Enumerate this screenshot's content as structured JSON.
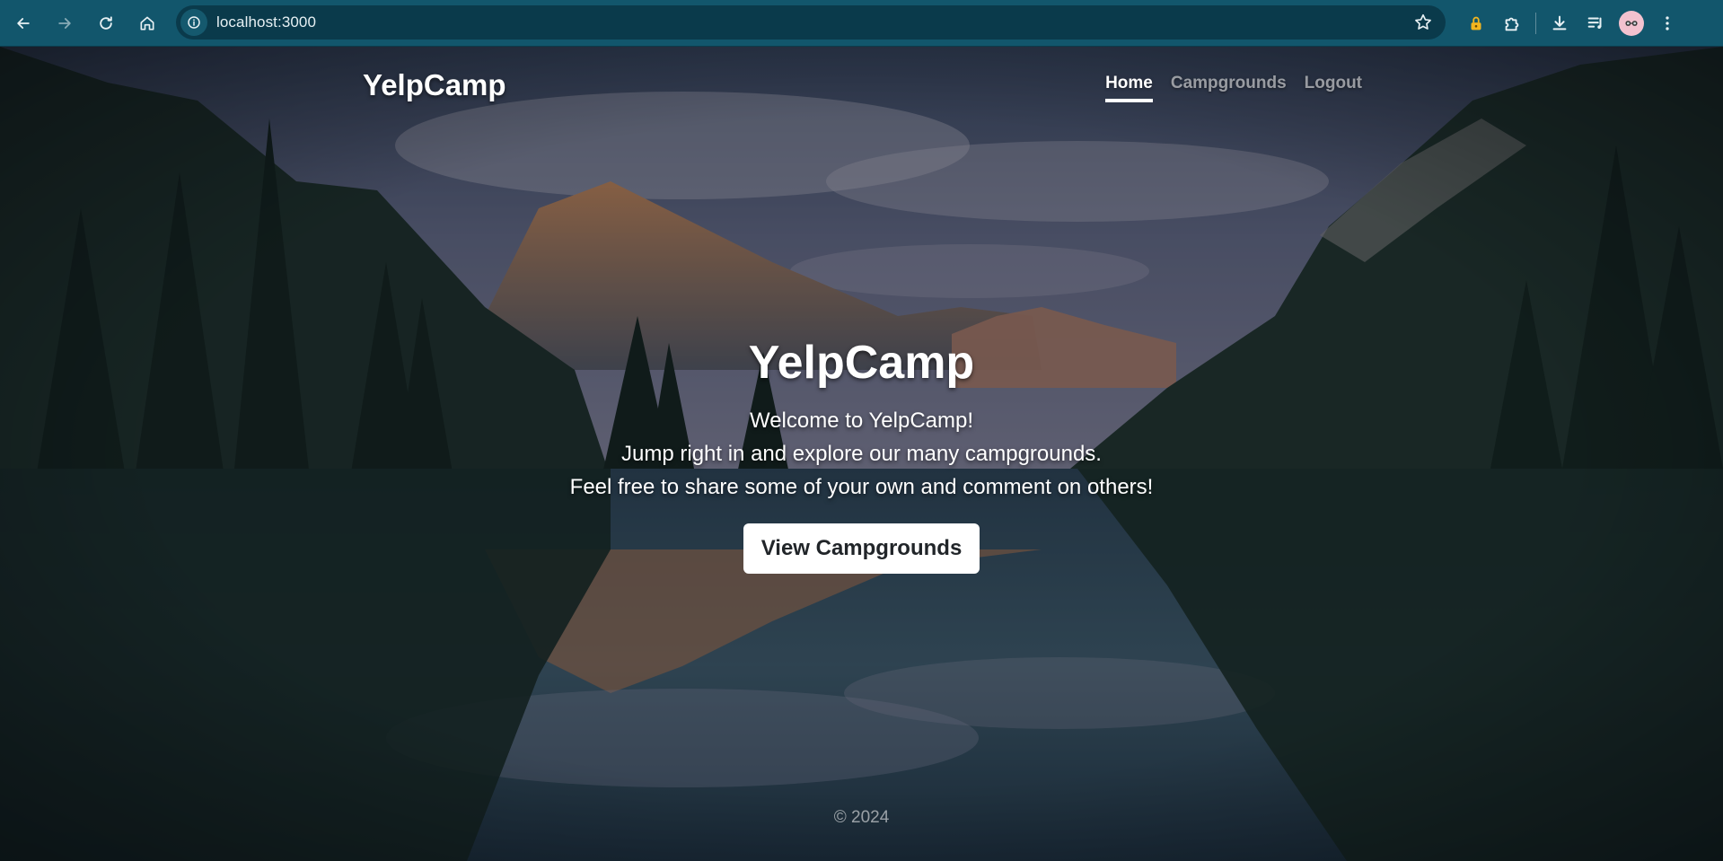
{
  "browser": {
    "url": "localhost:3000",
    "icons": {
      "back": "arrow-left-icon",
      "forward": "arrow-right-icon",
      "reload": "reload-icon",
      "home": "home-icon",
      "site_info": "info-icon",
      "bookmark": "star-icon",
      "extension_lock": "lock-icon",
      "extensions": "puzzle-icon",
      "downloads": "download-icon",
      "media": "playlist-icon",
      "profile": "avatar-icon",
      "menu": "kebab-menu-icon"
    }
  },
  "site": {
    "brand": "YelpCamp",
    "nav": [
      {
        "label": "Home",
        "active": true
      },
      {
        "label": "Campgrounds",
        "active": false
      },
      {
        "label": "Logout",
        "active": false
      }
    ]
  },
  "hero": {
    "title": "YelpCamp",
    "lines": [
      "Welcome to YelpCamp!",
      "Jump right in and explore our many campgrounds.",
      "Feel free to share some of your own and comment on others!"
    ],
    "cta_label": "View Campgrounds"
  },
  "footer": {
    "copyright": "© 2024"
  },
  "colors": {
    "chrome": "#12566c",
    "omnibox": "#0a3a4b",
    "accent_white": "#ffffff"
  }
}
